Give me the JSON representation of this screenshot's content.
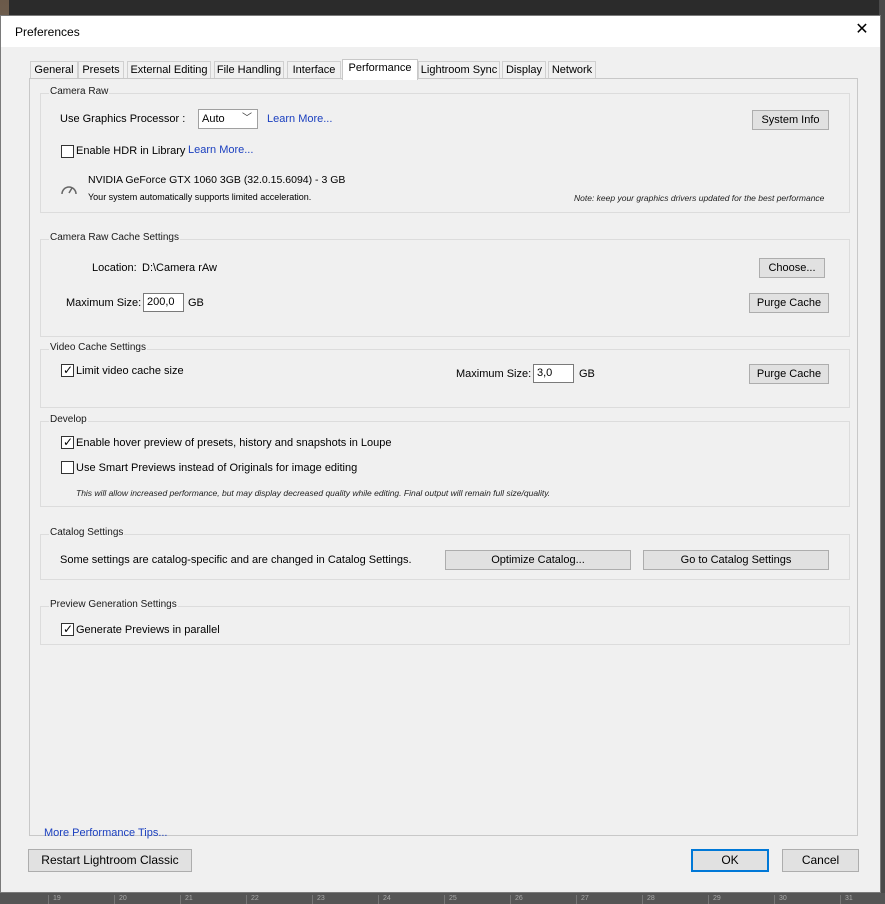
{
  "window": {
    "title": "Preferences"
  },
  "tabs": [
    {
      "label": "General"
    },
    {
      "label": "Presets"
    },
    {
      "label": "External Editing"
    },
    {
      "label": "File Handling"
    },
    {
      "label": "Interface"
    },
    {
      "label": "Performance"
    },
    {
      "label": "Lightroom Sync"
    },
    {
      "label": "Display"
    },
    {
      "label": "Network"
    }
  ],
  "active_tab": "Performance",
  "camera_raw": {
    "label": "Camera Raw",
    "gpu_label": "Use Graphics Processor :",
    "gpu_value": "Auto",
    "learn_more_1": "Learn More...",
    "system_info": "System Info",
    "hdr_label": "Enable HDR in Library",
    "hdr_checked": false,
    "learn_more_2": "Learn More...",
    "gpu_name": "NVIDIA GeForce GTX 1060 3GB (32.0.15.6094) - 3 GB",
    "gpu_status": "Your system automatically supports limited acceleration.",
    "note": "Note: keep your graphics drivers updated for the best performance"
  },
  "cache": {
    "label": "Camera Raw Cache Settings",
    "location_label": "Location:",
    "location_value": "D:\\Camera rAw",
    "choose": "Choose...",
    "max_label": "Maximum Size:",
    "max_value": "200,0",
    "unit": "GB",
    "purge": "Purge Cache"
  },
  "video": {
    "label": "Video Cache Settings",
    "limit_label": "Limit video cache size",
    "limit_checked": true,
    "max_label": "Maximum Size:",
    "max_value": "3,0",
    "unit": "GB",
    "purge": "Purge Cache"
  },
  "develop": {
    "label": "Develop",
    "hover_label": "Enable hover preview of presets, history and snapshots in Loupe",
    "hover_checked": true,
    "smart_label": "Use Smart Previews instead of Originals for image editing",
    "smart_checked": false,
    "note": "This will allow increased performance, but may display decreased quality while editing. Final output will remain full size/quality."
  },
  "catalog": {
    "label": "Catalog Settings",
    "text": "Some settings are catalog-specific and are changed in Catalog Settings.",
    "optimize": "Optimize Catalog...",
    "goto": "Go to Catalog Settings"
  },
  "preview": {
    "label": "Preview Generation Settings",
    "parallel_label": "Generate Previews in parallel",
    "parallel_checked": true
  },
  "tips_link": "More Performance Tips...",
  "footer": {
    "restart": "Restart Lightroom Classic",
    "ok": "OK",
    "cancel": "Cancel"
  },
  "background": {
    "bottom_numbers": [
      "19",
      "20",
      "21",
      "22",
      "23",
      "24",
      "25",
      "26",
      "27",
      "28",
      "29",
      "30",
      "31"
    ]
  }
}
